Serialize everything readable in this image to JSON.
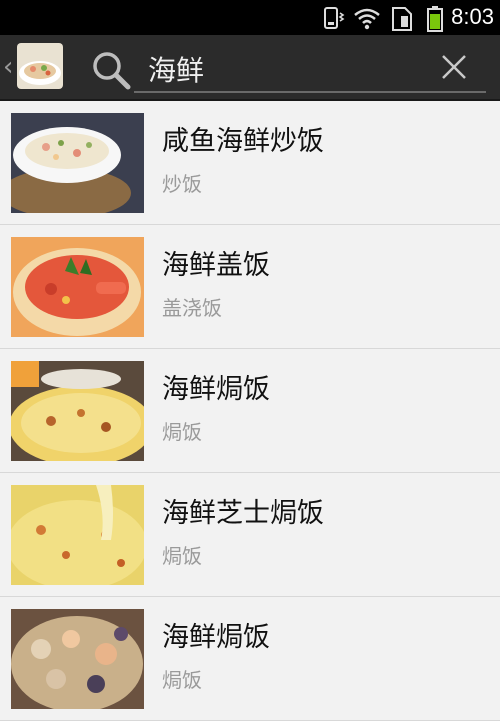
{
  "status_bar": {
    "time": "8:03"
  },
  "search": {
    "query": "海鲜"
  },
  "results": [
    {
      "title": "咸鱼海鲜炒饭",
      "category": "炒饭"
    },
    {
      "title": "海鲜盖饭",
      "category": "盖浇饭"
    },
    {
      "title": "海鲜焗饭",
      "category": "焗饭"
    },
    {
      "title": "海鲜芝士焗饭",
      "category": "焗饭"
    },
    {
      "title": "海鲜焗饭",
      "category": "焗饭"
    }
  ],
  "colors": {
    "status_bar": "#000000",
    "action_bar": "#2b2b2b",
    "list_bg": "#f2f2f2",
    "divider": "#d8d8d8"
  }
}
